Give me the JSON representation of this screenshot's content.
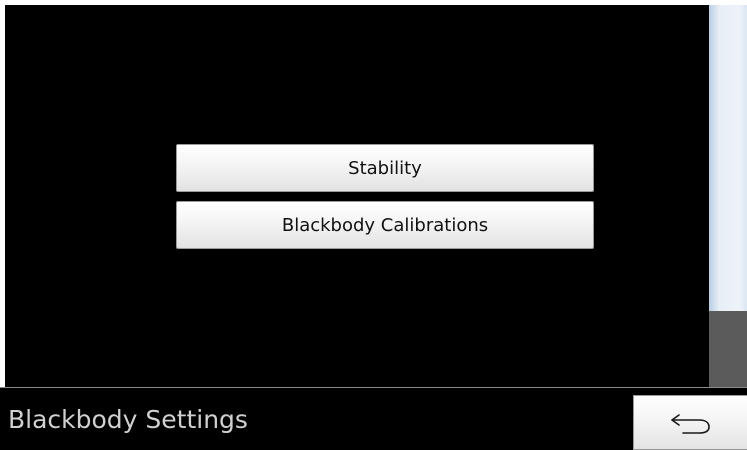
{
  "screen": {
    "title": "Blackbody Settings"
  },
  "menu": {
    "items": [
      {
        "label": "Stability"
      },
      {
        "label": "Blackbody Calibrations"
      }
    ]
  },
  "footer": {
    "back_icon": "back-arrow-icon"
  },
  "colors": {
    "background": "#000000",
    "button_face": "#f4f4f4",
    "title_text": "#d0d0d0",
    "scroll_track": "#e7eef6",
    "scroll_thumb": "#5b5b5b"
  }
}
